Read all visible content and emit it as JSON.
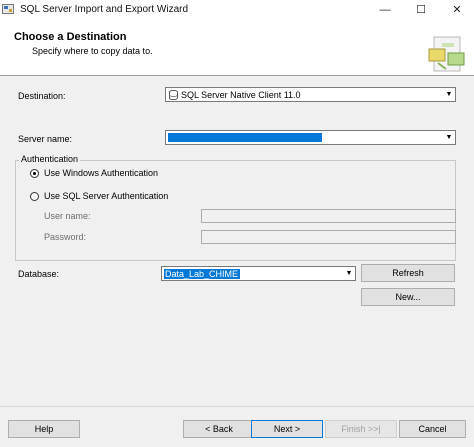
{
  "window": {
    "title": "SQL Server Import and Export Wizard",
    "minimize_glyph": "—",
    "maximize_glyph": "☐",
    "close_glyph": "✕"
  },
  "header": {
    "title": "Choose a Destination",
    "subtitle": "Specify where to copy data to."
  },
  "destination": {
    "label": "Destination:",
    "value": "SQL Server Native Client 11.0",
    "icon": "database-icon"
  },
  "server": {
    "label": "Server name:",
    "value": ""
  },
  "authentication": {
    "legend": "Authentication",
    "windows_label": "Use Windows Authentication",
    "windows_selected": true,
    "sql_label": "Use SQL Server Authentication",
    "sql_selected": false,
    "username_label": "User name:",
    "username_value": "",
    "password_label": "Password:",
    "password_value": ""
  },
  "database": {
    "label": "Database:",
    "value": "Data_Lab_CHIME",
    "refresh_label": "Refresh",
    "new_label": "New..."
  },
  "footer": {
    "help_label": "Help",
    "back_label": "< Back",
    "next_label": "Next >",
    "finish_label": "Finish >>|",
    "cancel_label": "Cancel"
  },
  "colors": {
    "selection": "#0078d7",
    "panel": "#f0f0f0"
  }
}
